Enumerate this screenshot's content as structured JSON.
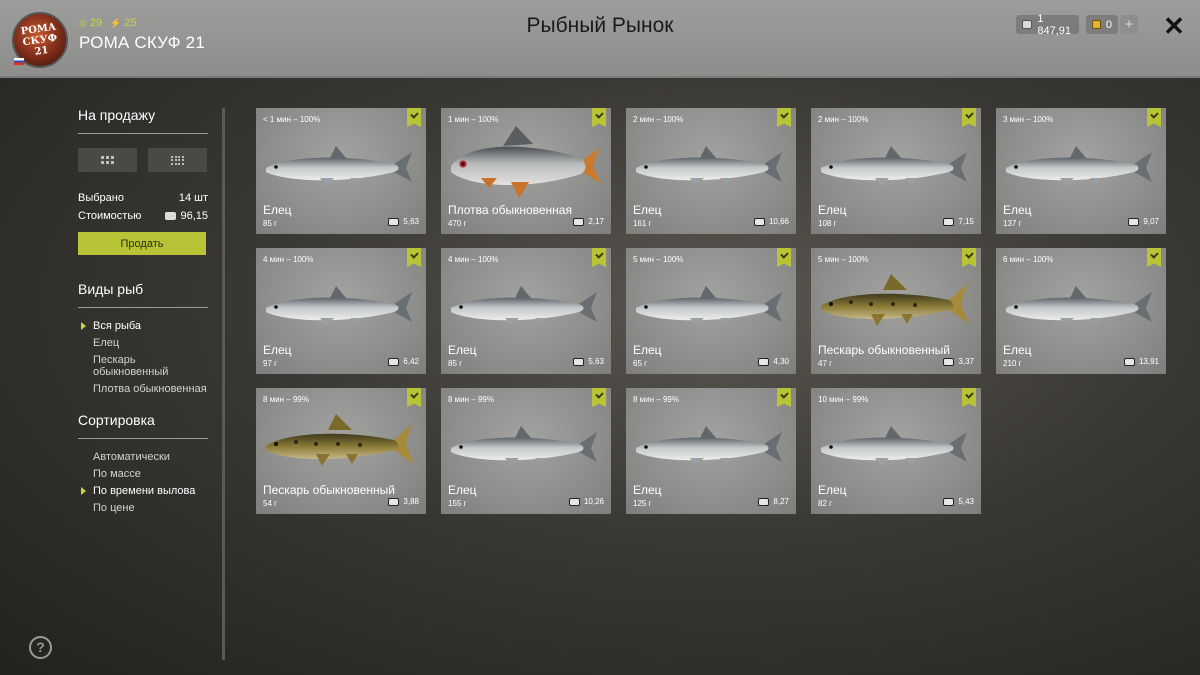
{
  "header": {
    "title": "Рыбный Рынок",
    "player_name": "РОМА СКУФ 21",
    "avatar_text": "РОМА СКУФ 21",
    "level": "29",
    "energy": "25",
    "silver": "1 847,91",
    "gold": "0",
    "add_label": "+",
    "close_label": "✕"
  },
  "sidebar": {
    "for_sale_heading": "На продажу",
    "selected_label": "Выбрано",
    "selected_value": "14 шт",
    "cost_label": "Стоимостью",
    "cost_value": "96,15",
    "sell_label": "Продать",
    "fish_types_heading": "Виды рыб",
    "fish_types": [
      "Вся рыба",
      "Елец",
      "Пескарь обыкновенный",
      "Плотва обыкновенная"
    ],
    "fish_types_active": 0,
    "sort_heading": "Сортировка",
    "sort_options": [
      "Автоматически",
      "По массе",
      "По времени вылова",
      "По цене"
    ],
    "sort_active": 2,
    "help_label": "?"
  },
  "colors": {
    "accent": "#b8c435",
    "card_bg": "#8e8e8c"
  },
  "fish": [
    {
      "time": "< 1 мин – 100%",
      "name": "Елец",
      "weight": "85 г",
      "price": "5,63",
      "species": "dace"
    },
    {
      "time": "1 мин – 100%",
      "name": "Плотва обыкновенная",
      "weight": "470 г",
      "price": "2,17",
      "species": "roach"
    },
    {
      "time": "2 мин – 100%",
      "name": "Елец",
      "weight": "161 г",
      "price": "10,66",
      "species": "dace"
    },
    {
      "time": "2 мин – 100%",
      "name": "Елец",
      "weight": "108 г",
      "price": "7,15",
      "species": "dace"
    },
    {
      "time": "3 мин – 100%",
      "name": "Елец",
      "weight": "137 г",
      "price": "9,07",
      "species": "dace"
    },
    {
      "time": "4 мин – 100%",
      "name": "Елец",
      "weight": "97 г",
      "price": "6,42",
      "species": "dace"
    },
    {
      "time": "4 мин – 100%",
      "name": "Елец",
      "weight": "85 г",
      "price": "5,63",
      "species": "dace"
    },
    {
      "time": "5 мин – 100%",
      "name": "Елец",
      "weight": "65 г",
      "price": "4,30",
      "species": "dace"
    },
    {
      "time": "5 мин – 100%",
      "name": "Пескарь обыкновенный",
      "weight": "47 г",
      "price": "3,37",
      "species": "gudgeon"
    },
    {
      "time": "6 мин – 100%",
      "name": "Елец",
      "weight": "210 г",
      "price": "13,91",
      "species": "dace"
    },
    {
      "time": "8 мин – 99%",
      "name": "Пескарь обыкновенный",
      "weight": "54 г",
      "price": "3,88",
      "species": "gudgeon"
    },
    {
      "time": "8 мин – 99%",
      "name": "Елец",
      "weight": "155 г",
      "price": "10,26",
      "species": "dace"
    },
    {
      "time": "8 мин – 99%",
      "name": "Елец",
      "weight": "125 г",
      "price": "8,27",
      "species": "dace"
    },
    {
      "time": "10 мин – 99%",
      "name": "Елец",
      "weight": "82 г",
      "price": "5,43",
      "species": "dace"
    }
  ]
}
